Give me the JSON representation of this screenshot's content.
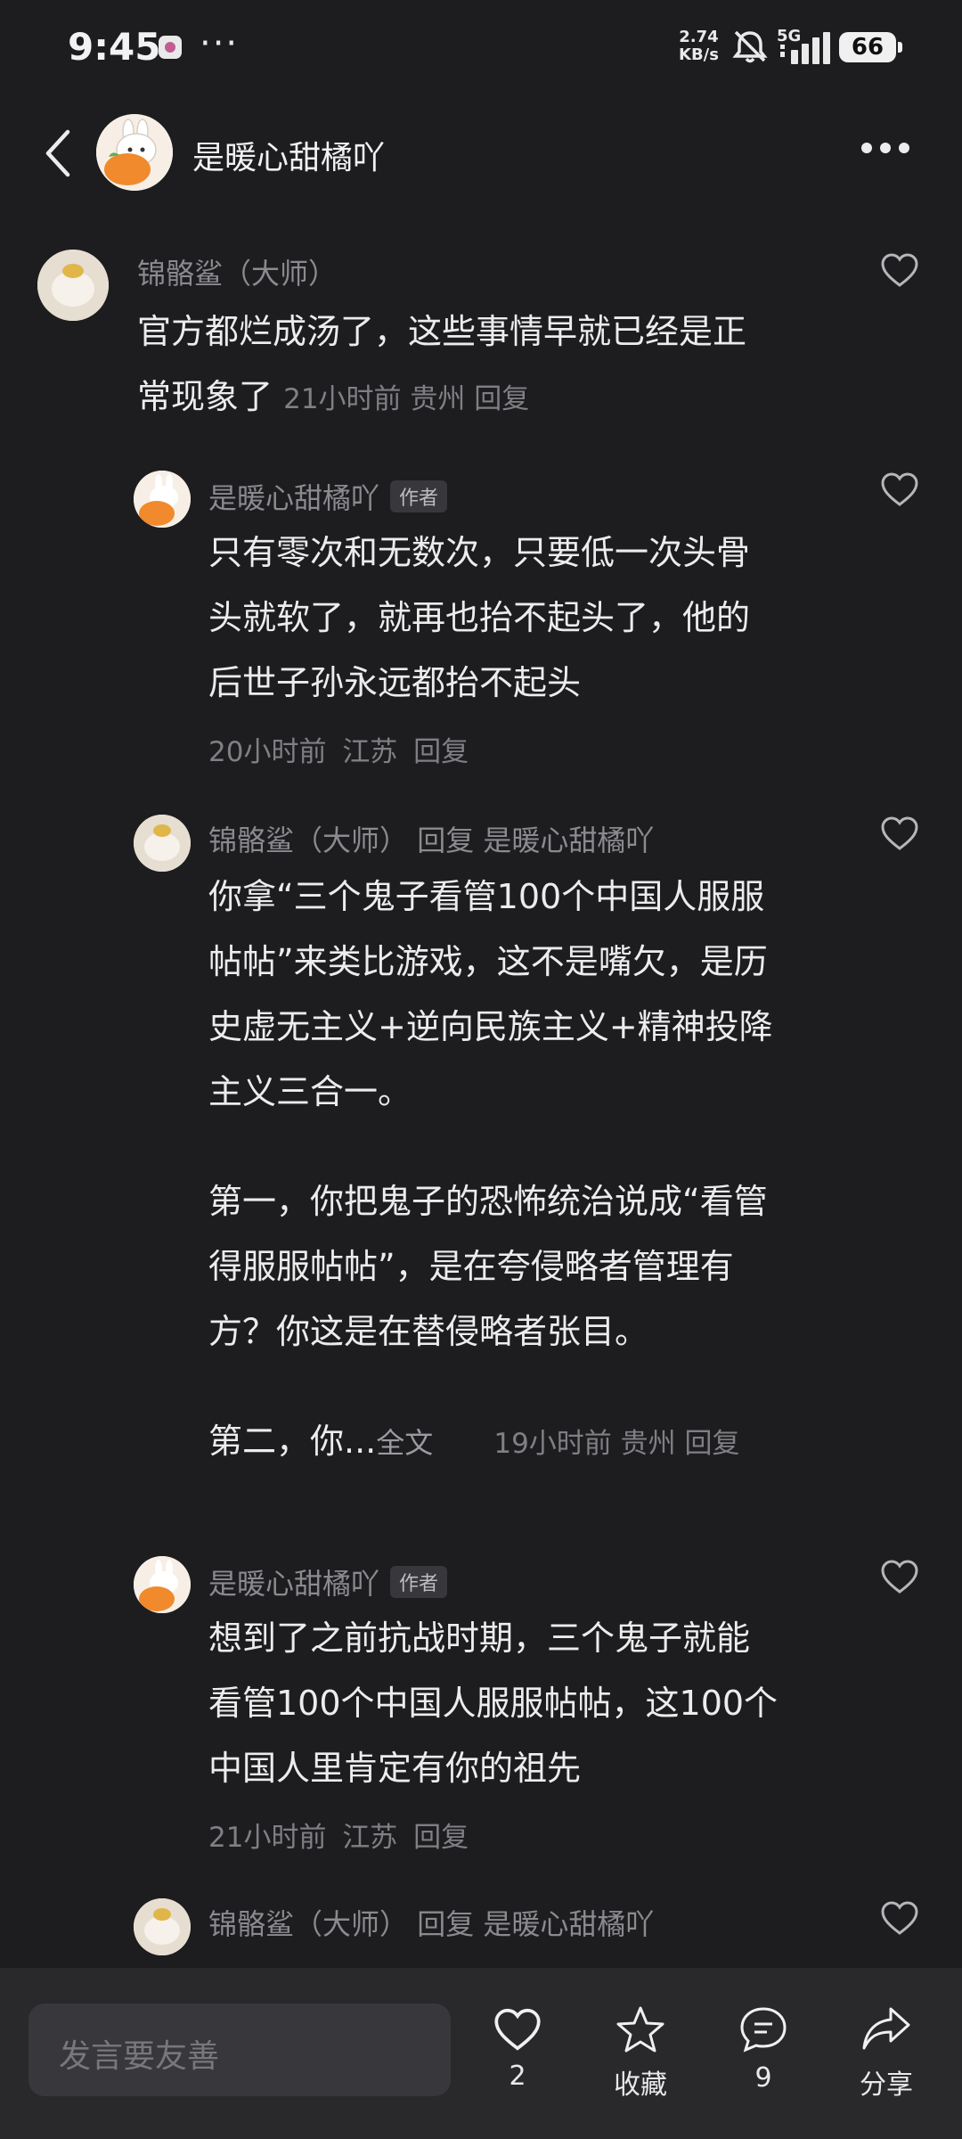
{
  "status_bar": {
    "time": "9:45",
    "dots": "···",
    "net_speed_value": "2.74",
    "net_speed_unit": "KB/s",
    "signal_label": "5G",
    "battery": "66"
  },
  "header": {
    "title": "是暖心甜橘吖",
    "back_icon": "chevron-left-icon",
    "more_icon": "more-horizontal-icon"
  },
  "comments": [
    {
      "user": "锦骼鲨（大师）",
      "lines": [
        "官方都烂成汤了，这些事情早就已经是正",
        "常现象了"
      ],
      "time": "21小时前",
      "location": "贵州",
      "reply": "回复"
    },
    {
      "user": "是暖心甜橘吖",
      "author_tag": "作者",
      "lines": [
        "只有零次和无数次，只要低一次头骨",
        "头就软了，就再也抬不起头了，他的",
        "后世子孙永远都抬不起头"
      ],
      "time": "20小时前",
      "location": "江苏",
      "reply": "回复"
    },
    {
      "user": "锦骼鲨（大师）",
      "reply_word": "回复",
      "reply_to": "是暖心甜橘吖",
      "lines": [
        "你拿“三个鬼子看管100个中国人服服",
        "帖帖”来类比游戏，这不是嘴欠，是历",
        "史虚无主义+逆向民族主义+精神投降",
        "主义三合一。",
        "",
        "第一，你把鬼子的恐怖统治说成“看管",
        "得服服帖帖”，是在夸侵略者管理有",
        "方？你这是在替侵略者张目。",
        ""
      ],
      "last_line": "第二，你...",
      "full_text": "全文",
      "time": "19小时前",
      "location": "贵州",
      "reply": "回复"
    },
    {
      "user": "是暖心甜橘吖",
      "author_tag": "作者",
      "lines": [
        "想到了之前抗战时期，三个鬼子就能",
        "看管100个中国人服服帖帖，这100个",
        "中国人里肯定有你的祖先"
      ],
      "time": "21小时前",
      "location": "江苏",
      "reply": "回复"
    },
    {
      "user": "锦骼鲨（大师）",
      "reply_word": "回复",
      "reply_to": "是暖心甜橘吖"
    }
  ],
  "bottom_bar": {
    "input_placeholder": "发言要友善",
    "like_count": "2",
    "favorite_label": "收藏",
    "comment_count": "9",
    "share_label": "分享"
  },
  "colors": {
    "background": "#1d1d20",
    "bottom_bar": "#29292c",
    "text_primary": "#ececec",
    "text_secondary": "#8a8a8f"
  }
}
